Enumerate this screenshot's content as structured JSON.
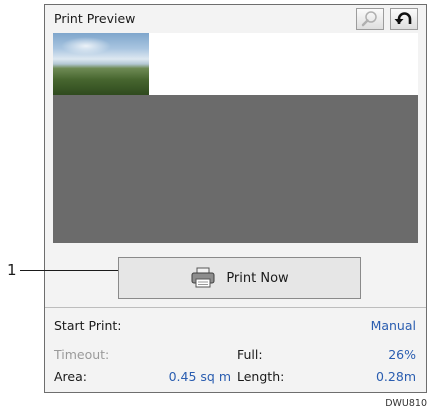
{
  "panel": {
    "title": "Print Preview",
    "zoom_icon": "magnifier-icon",
    "undo_icon": "undo-arrow-icon"
  },
  "print_button": {
    "label": "Print Now",
    "icon": "printer-icon"
  },
  "settings": {
    "start_print_label": "Start Print:",
    "start_print_value": "Manual",
    "timeout_label": "Timeout:",
    "full_label": "Full:",
    "full_value": "26%",
    "area_label": "Area:",
    "area_value": "0.45 sq m",
    "length_label": "Length:",
    "length_value": "0.28m"
  },
  "callout": {
    "number": "1"
  },
  "figure_code": "DWU810"
}
